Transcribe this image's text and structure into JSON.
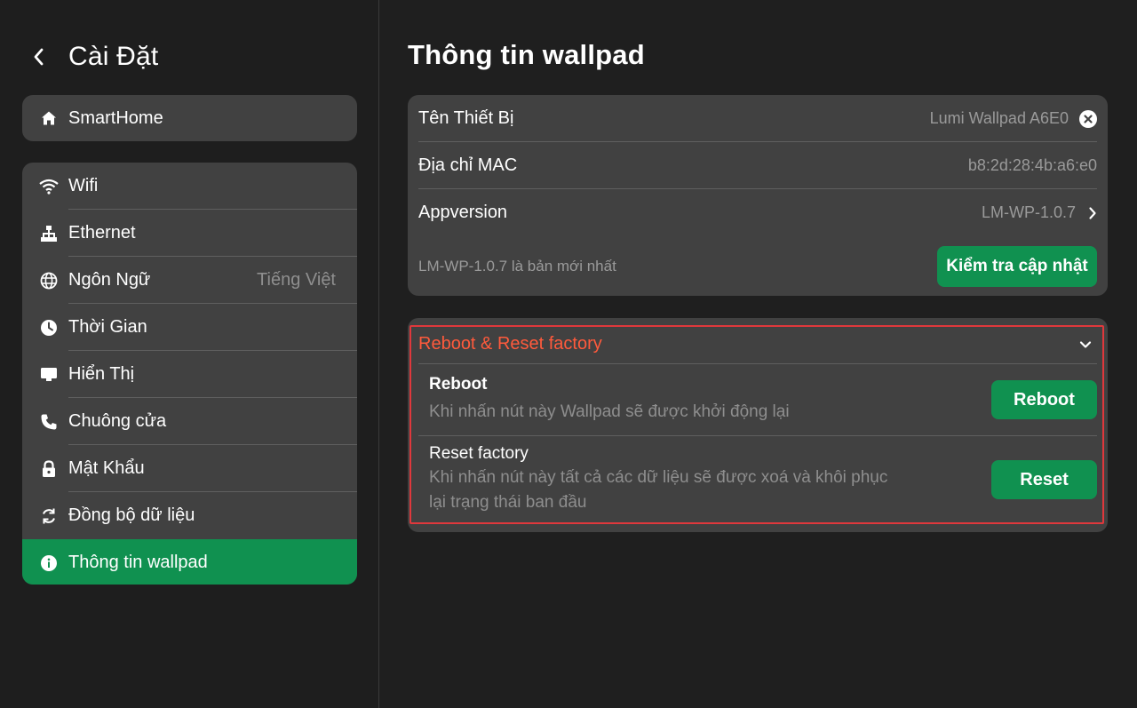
{
  "sidebar": {
    "title": "Cài Đặt",
    "top_item": {
      "label": "SmartHome",
      "icon": "home-icon"
    },
    "items": [
      {
        "label": "Wifi",
        "icon": "wifi-icon",
        "value": ""
      },
      {
        "label": "Ethernet",
        "icon": "ethernet-icon",
        "value": ""
      },
      {
        "label": "Ngôn Ngữ",
        "icon": "globe-icon",
        "value": "Tiếng Việt"
      },
      {
        "label": "Thời Gian",
        "icon": "clock-icon",
        "value": ""
      },
      {
        "label": "Hiển Thị",
        "icon": "monitor-icon",
        "value": ""
      },
      {
        "label": "Chuông cửa",
        "icon": "phone-icon",
        "value": ""
      },
      {
        "label": "Mật Khẩu",
        "icon": "lock-icon",
        "value": ""
      },
      {
        "label": "Đồng bộ dữ liệu",
        "icon": "sync-icon",
        "value": ""
      },
      {
        "label": "Thông tin wallpad",
        "icon": "info-icon",
        "value": "",
        "active": true
      }
    ]
  },
  "main": {
    "title": "Thông tin wallpad",
    "info": {
      "device_name_label": "Tên Thiết Bị",
      "device_name_value": "Lumi Wallpad A6E0",
      "mac_label": "Địa chỉ MAC",
      "mac_value": "b8:2d:28:4b:a6:e0",
      "appversion_label": "Appversion",
      "appversion_value": "LM-WP-1.0.7",
      "update_note": "LM-WP-1.0.7 là bản mới nhất",
      "update_button": "Kiểm tra cập nhật"
    },
    "reset_section": {
      "title": "Reboot & Reset factory",
      "reboot": {
        "title": "Reboot",
        "desc": "Khi nhấn nút này Wallpad sẽ được khởi động lại",
        "button": "Reboot"
      },
      "reset": {
        "title": "Reset factory",
        "desc": "Khi nhấn nút này tất cả các dữ liệu sẽ được xoá và khôi phục lại trạng thái ban đầu",
        "button": "Reset"
      }
    }
  },
  "colors": {
    "accent_green": "#109150",
    "highlight_red": "#e0383c",
    "section_title_orange": "#ff5a3c"
  }
}
